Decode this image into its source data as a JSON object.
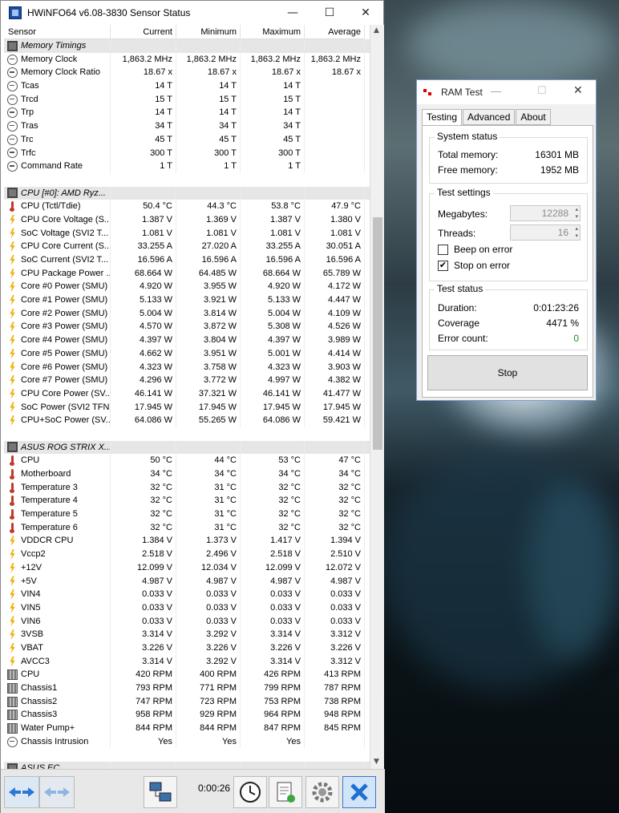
{
  "hwinfo": {
    "title": "HWiNFO64 v6.08-3830 Sensor Status",
    "columns": [
      "Sensor",
      "Current",
      "Minimum",
      "Maximum",
      "Average"
    ],
    "rows": [
      {
        "type": "group",
        "name": "Memory Timings",
        "icon": "memory-chip-icon"
      },
      {
        "name": "Memory Clock",
        "icon": "clock-icon",
        "cur": "1,863.2 MHz",
        "min": "1,863.2 MHz",
        "max": "1,863.2 MHz",
        "avg": "1,863.2 MHz"
      },
      {
        "name": "Memory Clock Ratio",
        "icon": "clock-icon",
        "cur": "18.67 x",
        "min": "18.67 x",
        "max": "18.67 x",
        "avg": "18.67 x"
      },
      {
        "name": "Tcas",
        "icon": "clock-icon",
        "cur": "14 T",
        "min": "14 T",
        "max": "14 T",
        "avg": ""
      },
      {
        "name": "Trcd",
        "icon": "clock-icon",
        "cur": "15 T",
        "min": "15 T",
        "max": "15 T",
        "avg": ""
      },
      {
        "name": "Trp",
        "icon": "clock-icon",
        "cur": "14 T",
        "min": "14 T",
        "max": "14 T",
        "avg": ""
      },
      {
        "name": "Tras",
        "icon": "clock-icon",
        "cur": "34 T",
        "min": "34 T",
        "max": "34 T",
        "avg": ""
      },
      {
        "name": "Trc",
        "icon": "clock-icon",
        "cur": "45 T",
        "min": "45 T",
        "max": "45 T",
        "avg": ""
      },
      {
        "name": "Trfc",
        "icon": "clock-icon",
        "cur": "300 T",
        "min": "300 T",
        "max": "300 T",
        "avg": ""
      },
      {
        "name": "Command Rate",
        "icon": "clock-icon",
        "cur": "1 T",
        "min": "1 T",
        "max": "1 T",
        "avg": ""
      },
      {
        "type": "blank"
      },
      {
        "type": "group",
        "name": "CPU [#0]: AMD Ryz...",
        "icon": "cpu-chip-icon"
      },
      {
        "name": "CPU (Tctl/Tdie)",
        "icon": "thermometer-icon",
        "cur": "50.4 °C",
        "min": "44.3 °C",
        "max": "53.8 °C",
        "avg": "47.9 °C"
      },
      {
        "name": "CPU Core Voltage (S...",
        "icon": "bolt-icon",
        "cur": "1.387 V",
        "min": "1.369 V",
        "max": "1.387 V",
        "avg": "1.380 V"
      },
      {
        "name": "SoC Voltage (SVI2 T...",
        "icon": "bolt-icon",
        "cur": "1.081 V",
        "min": "1.081 V",
        "max": "1.081 V",
        "avg": "1.081 V"
      },
      {
        "name": "CPU Core Current (S...",
        "icon": "bolt-icon",
        "cur": "33.255 A",
        "min": "27.020 A",
        "max": "33.255 A",
        "avg": "30.051 A"
      },
      {
        "name": "SoC Current (SVI2 T...",
        "icon": "bolt-icon",
        "cur": "16.596 A",
        "min": "16.596 A",
        "max": "16.596 A",
        "avg": "16.596 A"
      },
      {
        "name": "CPU Package Power ...",
        "icon": "bolt-icon",
        "cur": "68.664 W",
        "min": "64.485 W",
        "max": "68.664 W",
        "avg": "65.789 W"
      },
      {
        "name": "Core #0 Power (SMU)",
        "icon": "bolt-icon",
        "cur": "4.920 W",
        "min": "3.955 W",
        "max": "4.920 W",
        "avg": "4.172 W"
      },
      {
        "name": "Core #1 Power (SMU)",
        "icon": "bolt-icon",
        "cur": "5.133 W",
        "min": "3.921 W",
        "max": "5.133 W",
        "avg": "4.447 W"
      },
      {
        "name": "Core #2 Power (SMU)",
        "icon": "bolt-icon",
        "cur": "5.004 W",
        "min": "3.814 W",
        "max": "5.004 W",
        "avg": "4.109 W"
      },
      {
        "name": "Core #3 Power (SMU)",
        "icon": "bolt-icon",
        "cur": "4.570 W",
        "min": "3.872 W",
        "max": "5.308 W",
        "avg": "4.526 W"
      },
      {
        "name": "Core #4 Power (SMU)",
        "icon": "bolt-icon",
        "cur": "4.397 W",
        "min": "3.804 W",
        "max": "4.397 W",
        "avg": "3.989 W"
      },
      {
        "name": "Core #5 Power (SMU)",
        "icon": "bolt-icon",
        "cur": "4.662 W",
        "min": "3.951 W",
        "max": "5.001 W",
        "avg": "4.414 W"
      },
      {
        "name": "Core #6 Power (SMU)",
        "icon": "bolt-icon",
        "cur": "4.323 W",
        "min": "3.758 W",
        "max": "4.323 W",
        "avg": "3.903 W"
      },
      {
        "name": "Core #7 Power (SMU)",
        "icon": "bolt-icon",
        "cur": "4.296 W",
        "min": "3.772 W",
        "max": "4.997 W",
        "avg": "4.382 W"
      },
      {
        "name": "CPU Core Power (SV...",
        "icon": "bolt-icon",
        "cur": "46.141 W",
        "min": "37.321 W",
        "max": "46.141 W",
        "avg": "41.477 W"
      },
      {
        "name": "SoC Power (SVI2 TFN)",
        "icon": "bolt-icon",
        "cur": "17.945 W",
        "min": "17.945 W",
        "max": "17.945 W",
        "avg": "17.945 W"
      },
      {
        "name": "CPU+SoC Power (SV...",
        "icon": "bolt-icon",
        "cur": "64.086 W",
        "min": "55.265 W",
        "max": "64.086 W",
        "avg": "59.421 W"
      },
      {
        "type": "blank"
      },
      {
        "type": "group",
        "name": "ASUS ROG STRIX X...",
        "icon": "motherboard-chip-icon"
      },
      {
        "name": "CPU",
        "icon": "thermometer-icon",
        "cur": "50 °C",
        "min": "44 °C",
        "max": "53 °C",
        "avg": "47 °C"
      },
      {
        "name": "Motherboard",
        "icon": "thermometer-icon",
        "cur": "34 °C",
        "min": "34 °C",
        "max": "34 °C",
        "avg": "34 °C"
      },
      {
        "name": "Temperature 3",
        "icon": "thermometer-icon",
        "cur": "32 °C",
        "min": "31 °C",
        "max": "32 °C",
        "avg": "32 °C"
      },
      {
        "name": "Temperature 4",
        "icon": "thermometer-icon",
        "cur": "32 °C",
        "min": "31 °C",
        "max": "32 °C",
        "avg": "32 °C"
      },
      {
        "name": "Temperature 5",
        "icon": "thermometer-icon",
        "cur": "32 °C",
        "min": "31 °C",
        "max": "32 °C",
        "avg": "32 °C"
      },
      {
        "name": "Temperature 6",
        "icon": "thermometer-icon",
        "cur": "32 °C",
        "min": "31 °C",
        "max": "32 °C",
        "avg": "32 °C"
      },
      {
        "name": "VDDCR CPU",
        "icon": "bolt-icon",
        "cur": "1.384 V",
        "min": "1.373 V",
        "max": "1.417 V",
        "avg": "1.394 V"
      },
      {
        "name": "Vccp2",
        "icon": "bolt-icon",
        "cur": "2.518 V",
        "min": "2.496 V",
        "max": "2.518 V",
        "avg": "2.510 V"
      },
      {
        "name": "+12V",
        "icon": "bolt-icon",
        "cur": "12.099 V",
        "min": "12.034 V",
        "max": "12.099 V",
        "avg": "12.072 V"
      },
      {
        "name": "+5V",
        "icon": "bolt-icon",
        "cur": "4.987 V",
        "min": "4.987 V",
        "max": "4.987 V",
        "avg": "4.987 V"
      },
      {
        "name": "VIN4",
        "icon": "bolt-icon",
        "cur": "0.033 V",
        "min": "0.033 V",
        "max": "0.033 V",
        "avg": "0.033 V"
      },
      {
        "name": "VIN5",
        "icon": "bolt-icon",
        "cur": "0.033 V",
        "min": "0.033 V",
        "max": "0.033 V",
        "avg": "0.033 V"
      },
      {
        "name": "VIN6",
        "icon": "bolt-icon",
        "cur": "0.033 V",
        "min": "0.033 V",
        "max": "0.033 V",
        "avg": "0.033 V"
      },
      {
        "name": "3VSB",
        "icon": "bolt-icon",
        "cur": "3.314 V",
        "min": "3.292 V",
        "max": "3.314 V",
        "avg": "3.312 V"
      },
      {
        "name": "VBAT",
        "icon": "bolt-icon",
        "cur": "3.226 V",
        "min": "3.226 V",
        "max": "3.226 V",
        "avg": "3.226 V"
      },
      {
        "name": "AVCC3",
        "icon": "bolt-icon",
        "cur": "3.314 V",
        "min": "3.292 V",
        "max": "3.314 V",
        "avg": "3.312 V"
      },
      {
        "name": "CPU",
        "icon": "fan-icon",
        "cur": "420 RPM",
        "min": "400 RPM",
        "max": "426 RPM",
        "avg": "413 RPM"
      },
      {
        "name": "Chassis1",
        "icon": "fan-icon",
        "cur": "793 RPM",
        "min": "771 RPM",
        "max": "799 RPM",
        "avg": "787 RPM"
      },
      {
        "name": "Chassis2",
        "icon": "fan-icon",
        "cur": "747 RPM",
        "min": "723 RPM",
        "max": "753 RPM",
        "avg": "738 RPM"
      },
      {
        "name": "Chassis3",
        "icon": "fan-icon",
        "cur": "958 RPM",
        "min": "929 RPM",
        "max": "964 RPM",
        "avg": "948 RPM"
      },
      {
        "name": "Water Pump+",
        "icon": "fan-icon",
        "cur": "844 RPM",
        "min": "844 RPM",
        "max": "847 RPM",
        "avg": "845 RPM"
      },
      {
        "name": "Chassis Intrusion",
        "icon": "clock-icon",
        "cur": "Yes",
        "min": "Yes",
        "max": "Yes",
        "avg": ""
      },
      {
        "type": "blank"
      },
      {
        "type": "group",
        "name": "ASUS EC",
        "icon": "motherboard-chip-icon"
      }
    ],
    "elapsed": "0:00:26",
    "toolbar_icons": [
      "nav-arrows-icon",
      "nav-arrows-disabled-icon",
      "network-icon",
      "clock-icon",
      "report-icon",
      "settings-gear-icon",
      "close-x-icon"
    ]
  },
  "ramtest": {
    "title": "RAM Test",
    "tabs": [
      "Testing",
      "Advanced",
      "About"
    ],
    "system_status": {
      "title": "System status",
      "total_label": "Total memory:",
      "total_value": "16301 MB",
      "free_label": "Free memory:",
      "free_value": "1952 MB"
    },
    "test_settings": {
      "title": "Test settings",
      "mb_label": "Megabytes:",
      "mb_value": "12288",
      "threads_label": "Threads:",
      "threads_value": "16",
      "beep_label": "Beep on error",
      "beep_checked": false,
      "stop_label": "Stop on error",
      "stop_checked": true
    },
    "test_status": {
      "title": "Test status",
      "duration_label": "Duration:",
      "duration_value": "0:01:23:26",
      "coverage_label": "Coverage",
      "coverage_value": "4471 %",
      "errors_label": "Error count:",
      "errors_value": "0"
    },
    "stop_button": "Stop"
  },
  "colors": {
    "error_count": "#1a8f2a",
    "accent_blue": "#1a6fd8"
  }
}
